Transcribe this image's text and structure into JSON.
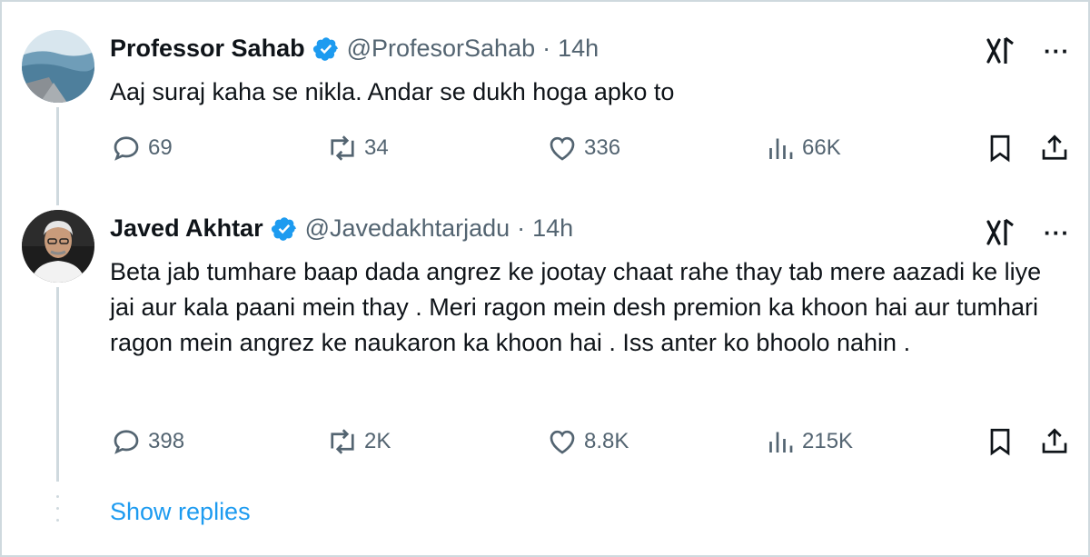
{
  "tweets": [
    {
      "name": "Professor Sahab",
      "handle": "@ProfesorSahab",
      "separator": "·",
      "time": "14h",
      "text": "Aaj suraj kaha se nikla. Andar se dukh hoga apko to",
      "stats": {
        "replies": "69",
        "reposts": "34",
        "likes": "336",
        "views": "66K"
      }
    },
    {
      "name": "Javed Akhtar",
      "handle": "@Javedakhtarjadu",
      "separator": "·",
      "time": "14h",
      "text": "Beta jab tumhare baap dada angrez ke jootay chaat rahe thay tab mere aazadi ke liye jai aur kala paani mein thay . Meri ragon mein desh premion ka khoon hai aur tumhari ragon mein angrez ke naukaron ka khoon hai .  Iss anter ko bhoolo nahin .",
      "stats": {
        "replies": "398",
        "reposts": "2K",
        "likes": "8.8K",
        "views": "215K"
      }
    }
  ],
  "show_replies": "Show replies",
  "colors": {
    "accent": "#1d9bf0",
    "verified": "#1d9bf0",
    "muted": "#536471",
    "text": "#0f1419",
    "border": "#cfd9de"
  },
  "icons": [
    "verified-badge-icon",
    "grok-icon",
    "more-icon",
    "reply-icon",
    "repost-icon",
    "like-icon",
    "views-icon",
    "bookmark-icon",
    "share-icon"
  ]
}
